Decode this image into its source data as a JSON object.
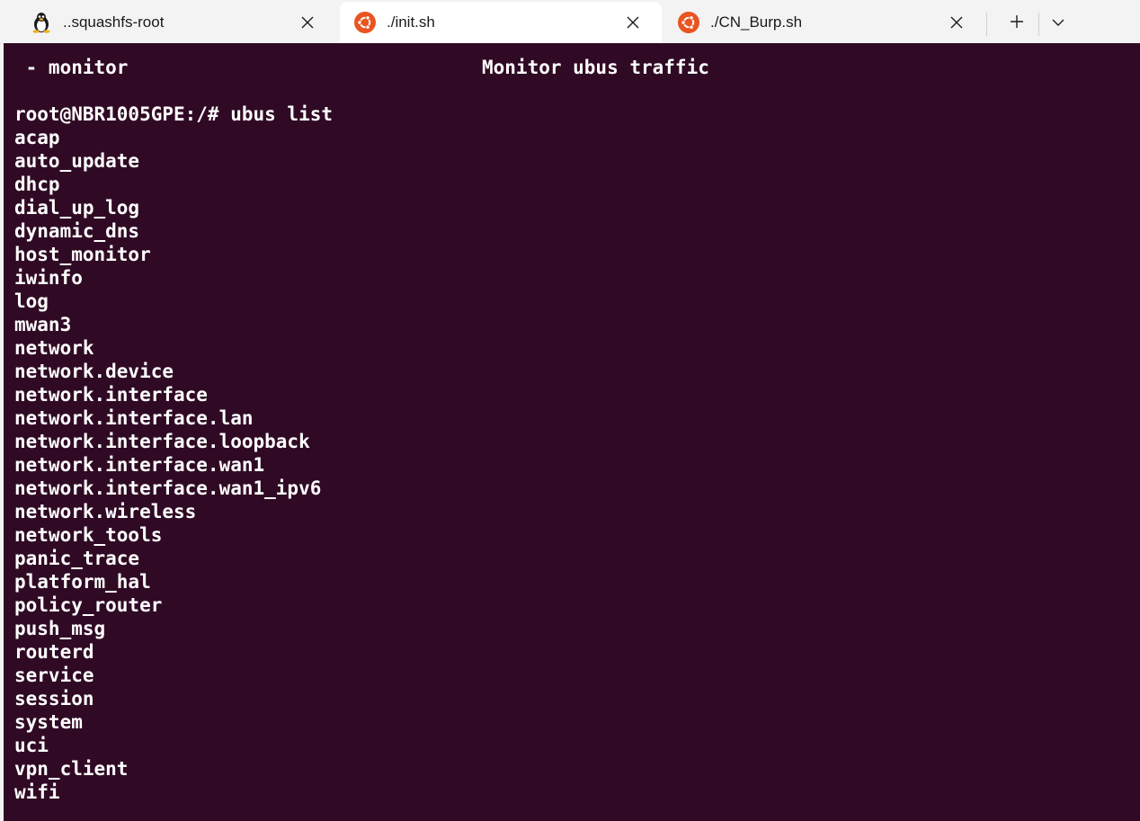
{
  "tabs": [
    {
      "title": "..squashfs-root",
      "icon": "linux-penguin-icon",
      "active": false
    },
    {
      "title": "./init.sh",
      "icon": "ubuntu-icon",
      "active": true
    },
    {
      "title": "./CN_Burp.sh",
      "icon": "ubuntu-icon",
      "active": false
    }
  ],
  "colors": {
    "terminal_bg": "#300a24",
    "terminal_fg": "#ffffff",
    "ubuntu_orange": "#e95420",
    "tabbar_bg": "#f3f3f3"
  },
  "terminal": {
    "help_command": " - monitor",
    "help_description": "Monitor ubus traffic",
    "prompt": "root@NBR1005GPE:/# ubus list",
    "output": [
      "acap",
      "auto_update",
      "dhcp",
      "dial_up_log",
      "dynamic_dns",
      "host_monitor",
      "iwinfo",
      "log",
      "mwan3",
      "network",
      "network.device",
      "network.interface",
      "network.interface.lan",
      "network.interface.loopback",
      "network.interface.wan1",
      "network.interface.wan1_ipv6",
      "network.wireless",
      "network_tools",
      "panic_trace",
      "platform_hal",
      "policy_router",
      "push_msg",
      "routerd",
      "service",
      "session",
      "system",
      "uci",
      "vpn_client",
      "wifi"
    ]
  }
}
